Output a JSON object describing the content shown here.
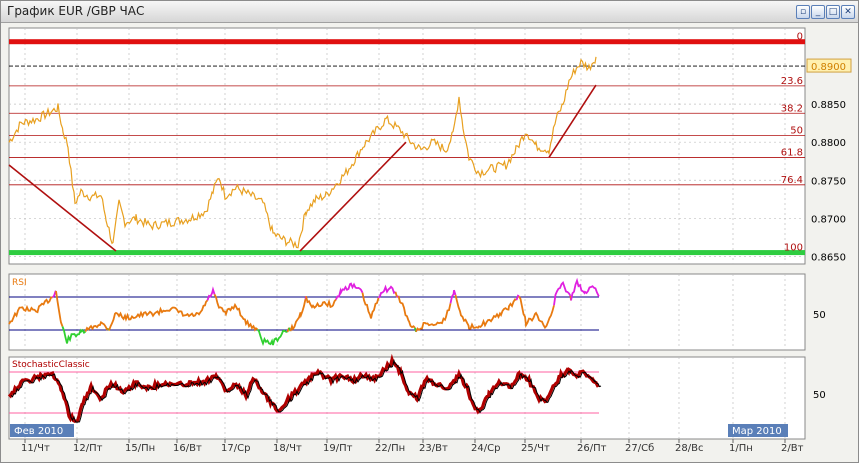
{
  "window": {
    "title": "График EUR /GBP  ЧАС",
    "buttons": [
      {
        "name": "restore-button",
        "glyph": "▫"
      },
      {
        "name": "minimize-button",
        "glyph": "_"
      },
      {
        "name": "maximize-button",
        "glyph": "□"
      },
      {
        "name": "close-button",
        "glyph": "✕"
      }
    ]
  },
  "colors": {
    "price": "#e8a020",
    "fibo": "#b01010",
    "support_band": "#2ecc40",
    "resistance_band": "#e01010",
    "price_tag_bg": "#fff0b0",
    "price_tag_text": "#d08000",
    "rsi_line": "#e87a10",
    "rsi_overbought": "#e020e0",
    "rsi_oversold": "#30d030",
    "stoch_main": "#b00000",
    "stoch_signal": "#000000",
    "stoch_levels": "#ff60a0",
    "rsi_levels": "#000080",
    "panel_bg": "#ffffff",
    "grid": "#c0c0c0",
    "date_label_bg": "#5a7fb8"
  },
  "main_chart": {
    "price_tag": "0.8900",
    "y_ticks": [
      "0.8850",
      "0.8800",
      "0.8750",
      "0.8700",
      "0.8650"
    ],
    "y_range": [
      0.864,
      0.895
    ],
    "fibo_levels": [
      {
        "label": "0",
        "value": 0.8932
      },
      {
        "label": "23.6",
        "value": 0.8874
      },
      {
        "label": "38.2",
        "value": 0.8838
      },
      {
        "label": "50",
        "value": 0.8809
      },
      {
        "label": "61.8",
        "value": 0.878
      },
      {
        "label": "76.4",
        "value": 0.8744
      },
      {
        "label": "100",
        "value": 0.8655
      }
    ]
  },
  "rsi_panel": {
    "label": "RSI",
    "tick": "50"
  },
  "stoch_panel": {
    "label": "StochasticClassic",
    "tick": "50"
  },
  "x_axis": {
    "month_left": "Фев 2010",
    "month_right": "Мар 2010",
    "labels": [
      "11/Чт",
      "12/Пт",
      "15/Пн",
      "16/Вт",
      "17/Ср",
      "18/Чт",
      "19/Пт",
      "22/Пн",
      "23/Вт",
      "24/Ср",
      "25/Чт",
      "26/Пт",
      "27/Сб",
      "28/Вс",
      "1/Пн",
      "2/Вт"
    ]
  }
}
